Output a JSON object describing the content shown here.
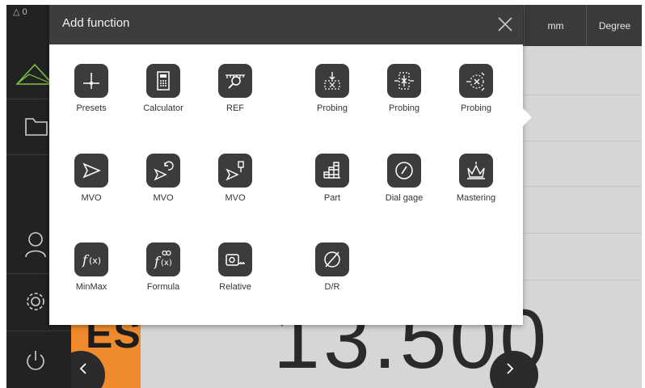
{
  "topbar": {
    "units": [
      "mm",
      "Degree"
    ]
  },
  "leftbar": {
    "top_text": "△ 0",
    "items": [
      "inspector",
      "file-management",
      "user-login",
      "settings",
      "power"
    ]
  },
  "workspace": {
    "axis_label": "ES",
    "position_value": "13.500"
  },
  "dialog": {
    "title": "Add function",
    "functions": [
      {
        "label": "Presets",
        "icon": "crosshair-icon"
      },
      {
        "label": "Calculator",
        "icon": "calculator-icon"
      },
      {
        "label": "REF",
        "icon": "ref-ruler-icon"
      },
      {
        "label": "Probing",
        "icon": "probing-edge-icon"
      },
      {
        "label": "Probing",
        "icon": "probing-centerline-icon"
      },
      {
        "label": "Probing",
        "icon": "probing-circle-icon"
      },
      {
        "label": "MVO",
        "icon": "mvo-arrow-icon"
      },
      {
        "label": "MVO",
        "icon": "mvo-rotate-icon"
      },
      {
        "label": "MVO",
        "icon": "mvo-marker-icon"
      },
      {
        "label": "Part",
        "icon": "part-counter-icon"
      },
      {
        "label": "Dial gage",
        "icon": "dial-gage-icon"
      },
      {
        "label": "Mastering",
        "icon": "mastering-crown-icon"
      },
      {
        "label": "MinMax",
        "icon": "minmax-function-icon"
      },
      {
        "label": "Formula",
        "icon": "formula-icon"
      },
      {
        "label": "Relative",
        "icon": "relative-tape-icon"
      },
      {
        "label": "D/R",
        "icon": "diameter-icon"
      }
    ]
  }
}
